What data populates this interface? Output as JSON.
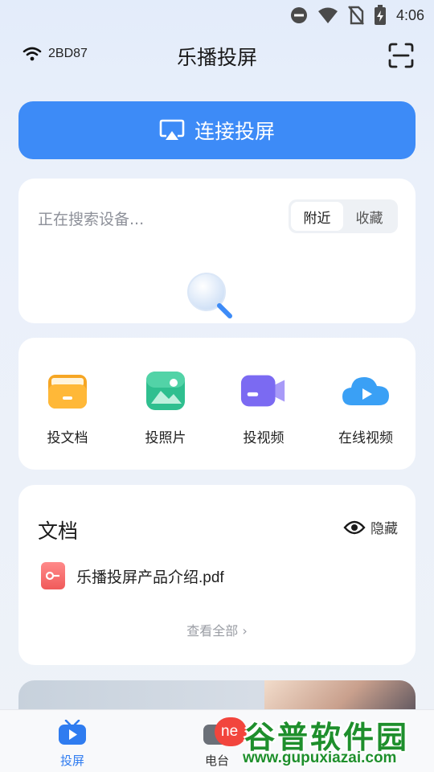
{
  "status_bar": {
    "time": "4:06",
    "icons": [
      "dnd-icon",
      "wifi-signal-icon",
      "no-sim-icon",
      "battery-charging-icon"
    ]
  },
  "header": {
    "wifi_name": "2BD87",
    "title": "乐播投屏"
  },
  "connect_button": {
    "label": "连接投屏"
  },
  "device_search": {
    "status_text": "正在搜索设备...",
    "segments": [
      "附近",
      "收藏"
    ],
    "selected_segment": "附近"
  },
  "tools": [
    {
      "label": "投文档",
      "icon": "document-folder-icon"
    },
    {
      "label": "投照片",
      "icon": "photo-icon"
    },
    {
      "label": "投视频",
      "icon": "video-camera-icon"
    },
    {
      "label": "在线视频",
      "icon": "cloud-play-icon"
    }
  ],
  "documents": {
    "title": "文档",
    "hide_label": "隐藏",
    "items": [
      {
        "name": "乐播投屏产品介绍.pdf",
        "icon": "pdf-icon"
      }
    ],
    "view_all_label": "查看全部"
  },
  "tabbar": {
    "tabs": [
      {
        "label": "投屏",
        "icon": "tv-play-icon",
        "active": true
      },
      {
        "label": "电台",
        "icon": "radio-icon",
        "active": false
      }
    ],
    "badge_text": "ne"
  },
  "watermark": {
    "main": "谷普软件园",
    "url": "www.gupuxiazai.com"
  },
  "colors": {
    "accent": "#3d8bf7",
    "badge": "#f2453d",
    "watermark": "#1e8f2c"
  }
}
